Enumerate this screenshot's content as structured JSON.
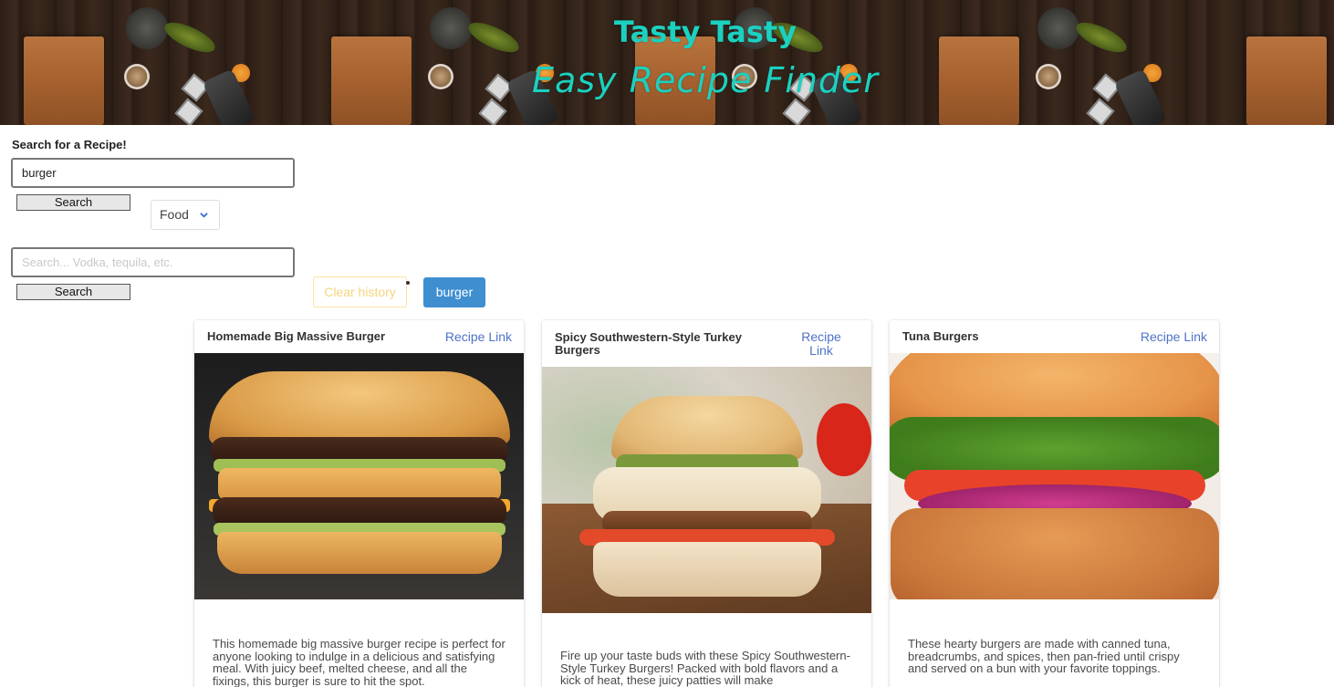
{
  "header": {
    "title": "Tasty Tasty",
    "subtitle": "Easy Recipe Finder"
  },
  "food_search": {
    "label": "Search for a Recipe!",
    "value": "burger",
    "button": "Search",
    "type_select": "Food"
  },
  "drink_search": {
    "placeholder": "Search... Vodka, tequila, etc.",
    "value": "",
    "button": "Search"
  },
  "history": {
    "clear_label": "Clear history",
    "items": [
      "burger"
    ]
  },
  "recipes": [
    {
      "title": "Homemade Big Massive Burger",
      "link_label": "Recipe Link",
      "description": "This homemade big massive burger recipe is perfect for anyone looking to indulge in a delicious and satisfying meal. With juicy beef, melted cheese, and all the fixings, this burger is sure to hit the spot."
    },
    {
      "title": "Spicy Southwestern-Style Turkey Burgers",
      "link_label": "Recipe Link",
      "description": "Fire up your taste buds with these Spicy Southwestern-Style Turkey Burgers! Packed with bold flavors and a kick of heat, these juicy patties will make"
    },
    {
      "title": "Tuna Burgers",
      "link_label": "Recipe Link",
      "description": "These hearty burgers are made with canned tuna, breadcrumbs, and spices, then pan-fried until crispy and served on a bun with your favorite toppings."
    }
  ],
  "colors": {
    "title": "#1bd1c0",
    "link": "#4f72c8",
    "history_button": "#3e8ed0",
    "clear_border": "#fbe3a3"
  }
}
